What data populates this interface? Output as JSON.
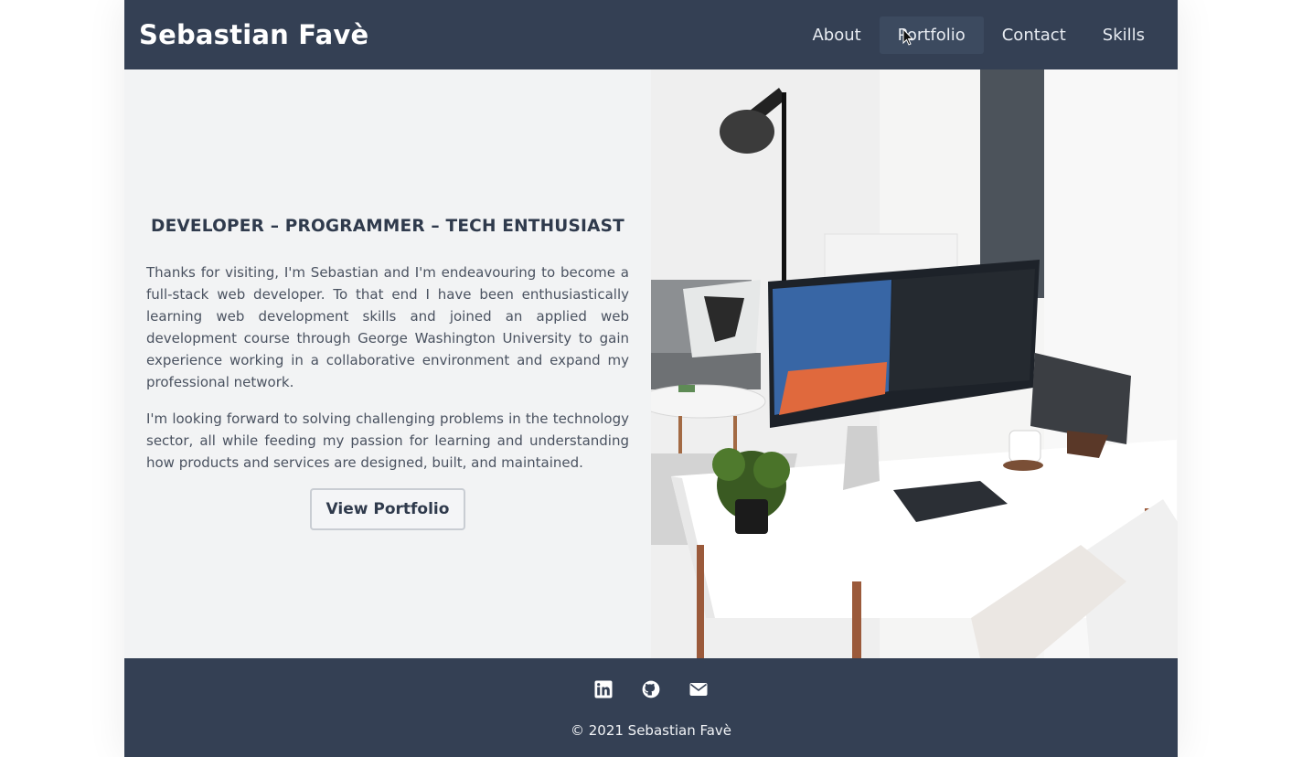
{
  "header": {
    "brand": "Sebastian Favè",
    "nav": [
      {
        "label": "About",
        "active": false
      },
      {
        "label": "Portfolio",
        "active": true
      },
      {
        "label": "Contact",
        "active": false
      },
      {
        "label": "Skills",
        "active": false
      }
    ]
  },
  "hero": {
    "tagline": "DEVELOPER  –  PROGRAMMER  –  TECH ENTHUSIAST",
    "paragraphs": [
      "Thanks for visiting, I'm Sebastian and I'm endeavouring to become a full-stack web developer. To that end I have been enthusiastically learning web development skills and joined an applied web development course through George Washington University to gain experience working in a collaborative environment and expand my professional network.",
      "I'm looking forward to solving challenging problems in the technology sector, all while feeding my passion for learning and understanding how products and services are designed, built, and maintained."
    ],
    "cta_label": "View Portfolio"
  },
  "footer": {
    "social": [
      "linkedin-icon",
      "github-icon",
      "email-icon"
    ],
    "copyright": "© 2021 Sebastian Favè"
  },
  "colors": {
    "header_bg": "#344054",
    "footer_bg": "#344054",
    "hero_left_bg": "#f2f3f4",
    "text_dark": "#2f3a4c",
    "text_body": "#4a5260"
  }
}
